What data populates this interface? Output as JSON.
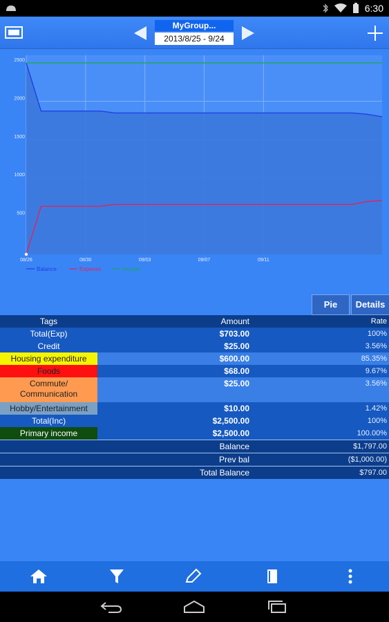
{
  "status_bar": {
    "time": "6:30"
  },
  "header": {
    "group_name": "MyGroup...",
    "date_range": "2013/8/25 - 9/24"
  },
  "chart_data": {
    "type": "area",
    "x": [
      "08/26",
      "08/27",
      "08/28",
      "08/29",
      "08/30",
      "08/31",
      "09/01",
      "09/02",
      "09/03",
      "09/04",
      "09/05",
      "09/06",
      "09/07",
      "09/08",
      "09/09",
      "09/10",
      "09/11",
      "09/12",
      "09/13",
      "09/14",
      "09/15",
      "09/16",
      "09/17",
      "09/18",
      "09/19"
    ],
    "xticks": [
      "08/26",
      "08/30",
      "09/03",
      "09/07",
      "09/11"
    ],
    "ylim": [
      0,
      2600
    ],
    "yticks": [
      500,
      1000,
      1500,
      2000,
      2500
    ],
    "grid": true,
    "legend_placement": "bottom-left",
    "series": [
      {
        "name": "Balance",
        "color": "#1f3fe6",
        "values": [
          2500,
          1872,
          1872,
          1872,
          1872,
          1872,
          1847,
          1847,
          1847,
          1847,
          1847,
          1847,
          1847,
          1847,
          1847,
          1847,
          1847,
          1847,
          1847,
          1847,
          1847,
          1847,
          1847,
          1830,
          1797
        ]
      },
      {
        "name": "Expense",
        "color": "#e0245e",
        "values": [
          0,
          628,
          628,
          628,
          628,
          628,
          653,
          653,
          653,
          653,
          653,
          653,
          653,
          653,
          653,
          653,
          653,
          653,
          653,
          653,
          653,
          653,
          653,
          690,
          703
        ]
      },
      {
        "name": "Income",
        "color": "#1aa65a",
        "values": [
          2500,
          2500,
          2500,
          2500,
          2500,
          2500,
          2500,
          2500,
          2500,
          2500,
          2500,
          2500,
          2500,
          2500,
          2500,
          2500,
          2500,
          2500,
          2500,
          2500,
          2500,
          2500,
          2500,
          2500,
          2500
        ]
      }
    ]
  },
  "tabs": {
    "pie": "Pie",
    "details": "Details"
  },
  "table": {
    "headers": {
      "tags": "Tags",
      "amount": "Amount",
      "rate": "Rate"
    },
    "rows": [
      {
        "tag": "Total(Exp)",
        "amount": "$703.00",
        "rate": "100%",
        "style": "dark"
      },
      {
        "tag": "Credit",
        "amount": "$25.00",
        "rate": "3.56%",
        "style": "dark"
      },
      {
        "tag": "Housing expenditure",
        "amount": "$600.00",
        "rate": "85.35%",
        "style": "light",
        "tag_color": "#f5f500"
      },
      {
        "tag": "Foods",
        "amount": "$68.00",
        "rate": "9.67%",
        "style": "dark",
        "tag_color": "#ff1010"
      },
      {
        "tag": "Commute/\nCommunication",
        "amount": "$25.00",
        "rate": "3.56%",
        "style": "light",
        "tag_color": "#ff9a50"
      },
      {
        "tag": "Hobby/Entertainment",
        "amount": "$10.00",
        "rate": "1.42%",
        "style": "dark",
        "tag_color": "#7aa0c4"
      },
      {
        "tag": "Total(Inc)",
        "amount": "$2,500.00",
        "rate": "100%",
        "style": "dark"
      },
      {
        "tag": "Primary income",
        "amount": "$2,500.00",
        "rate": "100.00%",
        "style": "dark",
        "tag_color": "#0f4d0f"
      }
    ],
    "summary": [
      {
        "label": "Balance",
        "value": "$1,797.00"
      },
      {
        "label": "Prev bal",
        "value": "($1,000.00)"
      },
      {
        "label": "Total Balance",
        "value": "$797.00"
      }
    ]
  },
  "bottom_nav": [
    "home-icon",
    "filter-icon",
    "edit-icon",
    "notebook-icon",
    "more-icon"
  ]
}
